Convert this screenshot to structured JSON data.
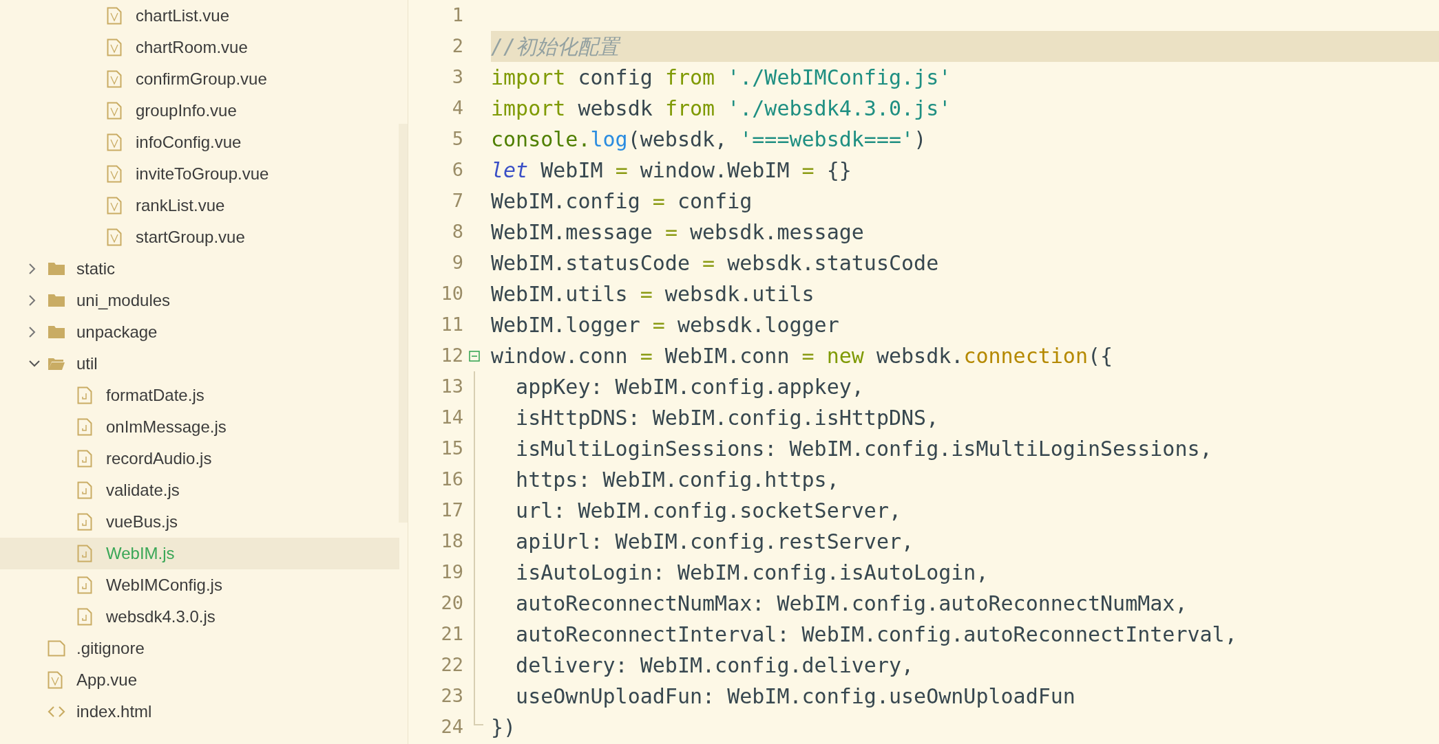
{
  "sidebar": {
    "tree": [
      {
        "children": [
          {
            "children": [
              {
                "kind": "vue",
                "label": "chartList.vue",
                "selected": false
              },
              {
                "kind": "vue",
                "label": "chartRoom.vue",
                "selected": false
              },
              {
                "kind": "vue",
                "label": "confirmGroup.vue",
                "selected": false
              },
              {
                "kind": "vue",
                "label": "groupInfo.vue",
                "selected": false
              },
              {
                "kind": "vue",
                "label": "infoConfig.vue",
                "selected": false
              },
              {
                "kind": "vue",
                "label": "inviteToGroup.vue",
                "selected": false
              },
              {
                "kind": "vue",
                "label": "rankList.vue",
                "selected": false
              },
              {
                "kind": "vue",
                "label": "startGroup.vue",
                "selected": false
              }
            ]
          }
        ]
      },
      {
        "kind": "folder",
        "label": "static",
        "expanded": false,
        "selected": false
      },
      {
        "kind": "folder",
        "label": "uni_modules",
        "expanded": false,
        "selected": false
      },
      {
        "kind": "folder",
        "label": "unpackage",
        "expanded": false,
        "selected": false
      },
      {
        "kind": "folder",
        "label": "util",
        "expanded": true,
        "selected": false,
        "children": [
          {
            "kind": "js",
            "label": "formatDate.js",
            "selected": false
          },
          {
            "kind": "js",
            "label": "onImMessage.js",
            "selected": false
          },
          {
            "kind": "js",
            "label": "recordAudio.js",
            "selected": false
          },
          {
            "kind": "js",
            "label": "validate.js",
            "selected": false
          },
          {
            "kind": "js",
            "label": "vueBus.js",
            "selected": false
          },
          {
            "kind": "js",
            "label": "WebIM.js",
            "selected": true
          },
          {
            "kind": "js",
            "label": "WebIMConfig.js",
            "selected": false
          },
          {
            "kind": "js",
            "label": "websdk4.3.0.js",
            "selected": false
          }
        ]
      },
      {
        "kind": "file",
        "label": ".gitignore",
        "selected": false
      },
      {
        "kind": "vue",
        "label": "App.vue",
        "selected": false
      },
      {
        "kind": "html",
        "label": "index.html",
        "selected": false
      }
    ]
  },
  "editor": {
    "lines": [
      {
        "number": "1",
        "highlighted": false
      },
      {
        "number": "2",
        "highlighted": true,
        "tokens": [
          {
            "kind": "comment",
            "text": "//初始化配置"
          }
        ]
      },
      {
        "number": "3",
        "highlighted": false,
        "tokens": [
          {
            "kind": "keyword",
            "text": "import"
          },
          {
            "kind": "plain",
            "text": " config "
          },
          {
            "kind": "keyword",
            "text": "from"
          },
          {
            "kind": "string",
            "text": " './WebIMConfig.js'"
          }
        ]
      },
      {
        "number": "4",
        "highlighted": false,
        "tokens": [
          {
            "kind": "keyword",
            "text": "import"
          },
          {
            "kind": "plain",
            "text": " websdk "
          },
          {
            "kind": "keyword",
            "text": "from"
          },
          {
            "kind": "string",
            "text": " './websdk4.3.0.js'"
          }
        ]
      },
      {
        "number": "5",
        "highlighted": false,
        "tokens": [
          {
            "kind": "builtin",
            "text": "console."
          },
          {
            "kind": "function",
            "text": "log"
          },
          {
            "kind": "plain",
            "text": "(websdk, "
          },
          {
            "kind": "string",
            "text": "'===websdk==='"
          },
          {
            "kind": "plain",
            "text": ")"
          }
        ]
      },
      {
        "number": "6",
        "highlighted": false,
        "tokens": [
          {
            "kind": "storage",
            "text": "let"
          },
          {
            "kind": "plain",
            "text": " WebIM "
          },
          {
            "kind": "operator",
            "text": "="
          },
          {
            "kind": "plain",
            "text": " window.WebIM "
          },
          {
            "kind": "operator",
            "text": "="
          },
          {
            "kind": "plain",
            "text": " {}"
          }
        ]
      },
      {
        "number": "7",
        "highlighted": false,
        "tokens": [
          {
            "kind": "plain",
            "text": "WebIM.config "
          },
          {
            "kind": "operator",
            "text": "="
          },
          {
            "kind": "plain",
            "text": " config"
          }
        ]
      },
      {
        "number": "8",
        "highlighted": false,
        "tokens": [
          {
            "kind": "plain",
            "text": "WebIM.message "
          },
          {
            "kind": "operator",
            "text": "="
          },
          {
            "kind": "plain",
            "text": " websdk.message"
          }
        ]
      },
      {
        "number": "9",
        "highlighted": false,
        "tokens": [
          {
            "kind": "plain",
            "text": "WebIM.statusCode "
          },
          {
            "kind": "operator",
            "text": "="
          },
          {
            "kind": "plain",
            "text": " websdk.statusCode"
          }
        ]
      },
      {
        "number": "10",
        "highlighted": false,
        "tokens": [
          {
            "kind": "plain",
            "text": "WebIM.utils "
          },
          {
            "kind": "operator",
            "text": "="
          },
          {
            "kind": "plain",
            "text": " websdk.utils"
          }
        ]
      },
      {
        "number": "11",
        "highlighted": false,
        "tokens": [
          {
            "kind": "plain",
            "text": "WebIM.logger "
          },
          {
            "kind": "operator",
            "text": "="
          },
          {
            "kind": "plain",
            "text": " websdk.logger"
          }
        ]
      },
      {
        "number": "12",
        "highlighted": false,
        "expanded": true,
        "tokens": [
          {
            "kind": "plain",
            "text": "window.conn "
          },
          {
            "kind": "operator",
            "text": "="
          },
          {
            "kind": "plain",
            "text": " WebIM.conn "
          },
          {
            "kind": "operator",
            "text": "="
          },
          {
            "kind": "keyword",
            "text": " new"
          },
          {
            "kind": "plain",
            "text": " websdk."
          },
          {
            "kind": "method",
            "text": "connection"
          },
          {
            "kind": "plain",
            "text": "({"
          }
        ],
        "children": [
          {
            "number": "13",
            "highlighted": false,
            "tokens": [
              {
                "kind": "plain",
                "text": "  appKey: WebIM.config.appkey,"
              }
            ]
          },
          {
            "number": "14",
            "highlighted": false,
            "tokens": [
              {
                "kind": "plain",
                "text": "  isHttpDNS: WebIM.config.isHttpDNS,"
              }
            ]
          },
          {
            "number": "15",
            "highlighted": false,
            "tokens": [
              {
                "kind": "plain",
                "text": "  isMultiLoginSessions: WebIM.config.isMultiLoginSessions,"
              }
            ]
          },
          {
            "number": "16",
            "highlighted": false,
            "tokens": [
              {
                "kind": "plain",
                "text": "  https: WebIM.config.https,"
              }
            ]
          },
          {
            "number": "17",
            "highlighted": false,
            "tokens": [
              {
                "kind": "plain",
                "text": "  url: WebIM.config.socketServer,"
              }
            ]
          },
          {
            "number": "18",
            "highlighted": false,
            "tokens": [
              {
                "kind": "plain",
                "text": "  apiUrl: WebIM.config.restServer,"
              }
            ]
          },
          {
            "number": "19",
            "highlighted": false,
            "tokens": [
              {
                "kind": "plain",
                "text": "  isAutoLogin: WebIM.config.isAutoLogin,"
              }
            ]
          },
          {
            "number": "20",
            "highlighted": false,
            "tokens": [
              {
                "kind": "plain",
                "text": "  autoReconnectNumMax: WebIM.config.autoReconnectNumMax,"
              }
            ]
          },
          {
            "number": "21",
            "highlighted": false,
            "tokens": [
              {
                "kind": "plain",
                "text": "  autoReconnectInterval: WebIM.config.autoReconnectInterval,"
              }
            ]
          },
          {
            "number": "22",
            "highlighted": false,
            "tokens": [
              {
                "kind": "plain",
                "text": "  delivery: WebIM.config.delivery,"
              }
            ]
          },
          {
            "number": "23",
            "highlighted": false,
            "tokens": [
              {
                "kind": "plain",
                "text": "  useOwnUploadFun: WebIM.config.useOwnUploadFun"
              }
            ]
          },
          {
            "number": "24",
            "highlighted": false,
            "tokens": [
              {
                "kind": "plain",
                "text": "})"
              }
            ]
          }
        ]
      }
    ]
  }
}
